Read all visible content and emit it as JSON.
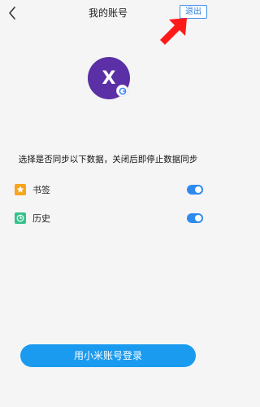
{
  "header": {
    "title": "我的账号",
    "logout_label": "退出"
  },
  "account": {
    "avatar_letter": "X",
    "provider_badge": "G"
  },
  "sync": {
    "description": "选择是否同步以下数据，关闭后即停止数据同步",
    "items": [
      {
        "label": "书签",
        "enabled": true,
        "icon": "star-icon"
      },
      {
        "label": "历史",
        "enabled": true,
        "icon": "clock-icon"
      }
    ]
  },
  "login": {
    "label": "用小米账号登录"
  },
  "colors": {
    "accent": "#1a9bf0",
    "avatar": "#5b2fa5",
    "toggle_on": "#2f8af0",
    "arrow": "#ff1a1a"
  }
}
